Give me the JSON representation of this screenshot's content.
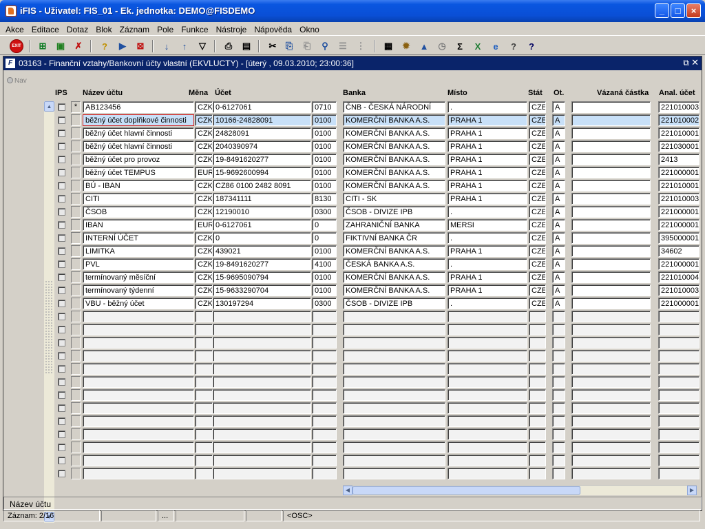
{
  "window": {
    "title": "iFIS - Uživatel: FIS_01 - Ek. jednotka: DEMO@FISDEMO",
    "minimize": "_",
    "maximize": "□",
    "close": "×"
  },
  "menu": [
    {
      "label": "Akce"
    },
    {
      "label": "Editace"
    },
    {
      "label": "Dotaz"
    },
    {
      "label": "Blok"
    },
    {
      "label": "Záznam"
    },
    {
      "label": "Pole"
    },
    {
      "label": "Funkce"
    },
    {
      "label": "Nástroje"
    },
    {
      "label": "Nápověda"
    },
    {
      "label": "Okno"
    }
  ],
  "toolbar": {
    "exit_label": "EXIT"
  },
  "form": {
    "icon_text": "F",
    "title": "03163 - Finanční vztahy/Bankovní účty vlastní (EKVLUCTY) - [úterý  , 09.03.2010; 23:00:36]",
    "restore": "⧉",
    "close": "✕",
    "nav_label": "Nav"
  },
  "columns": {
    "ips": "IPS",
    "nazev": "Název účtu",
    "mena": "Měna",
    "ucet": "Účet",
    "banka": "Banka",
    "misto": "Místo",
    "stat": "Stát",
    "ot": "Ot.",
    "vazana": "Vázaná částka",
    "anal": "Anal. účet"
  },
  "current_row_marker": "*",
  "rows": [
    {
      "nazev": "AB123456",
      "mena": "CZK",
      "ucet": "0-6127061",
      "kod": "0710",
      "banka": "ČNB - ČESKÁ NÁRODNÍ",
      "misto": ".",
      "stat": "CZE",
      "ot": "A",
      "vazana": "",
      "anal": "221010003"
    },
    {
      "nazev": "běžný účet doplňkové činnosti",
      "mena": "CZK",
      "ucet": "10166-24828091",
      "kod": "0100",
      "banka": "KOMERČNÍ BANKA A.S.",
      "misto": "PRAHA 1",
      "stat": "CZE",
      "ot": "A",
      "vazana": "",
      "anal": "221010002"
    },
    {
      "nazev": "běžný účet hlavní činnosti",
      "mena": "CZK",
      "ucet": "24828091",
      "kod": "0100",
      "banka": "KOMERČNÍ BANKA A.S.",
      "misto": "PRAHA 1",
      "stat": "CZE",
      "ot": "A",
      "vazana": "",
      "anal": "221010001"
    },
    {
      "nazev": "běžný účet hlavní činnosti",
      "mena": "CZK",
      "ucet": "2040390974",
      "kod": "0100",
      "banka": "KOMERČNÍ BANKA A.S.",
      "misto": "PRAHA 1",
      "stat": "CZE",
      "ot": "A",
      "vazana": "",
      "anal": "221030001"
    },
    {
      "nazev": "běžný účet pro provoz",
      "mena": "CZK",
      "ucet": "19-8491620277",
      "kod": "0100",
      "banka": "KOMERČNÍ BANKA A.S.",
      "misto": "PRAHA 1",
      "stat": "CZE",
      "ot": "A",
      "vazana": "",
      "anal": "2413"
    },
    {
      "nazev": "běžný účet TEMPUS",
      "mena": "EUR",
      "ucet": "15-9692600994",
      "kod": "0100",
      "banka": "KOMERČNÍ BANKA A.S.",
      "misto": "PRAHA 1",
      "stat": "CZE",
      "ot": "A",
      "vazana": "",
      "anal": "221000001"
    },
    {
      "nazev": "BÚ - IBAN",
      "mena": "CZK",
      "ucet": "CZ86 0100 2482 8091",
      "kod": "0100",
      "banka": "KOMERČNÍ BANKA A.S.",
      "misto": "PRAHA 1",
      "stat": "CZE",
      "ot": "A",
      "vazana": "",
      "anal": "221010001"
    },
    {
      "nazev": "CITI",
      "mena": "CZK",
      "ucet": "187341111",
      "kod": "8130",
      "banka": "CITI - SK",
      "misto": "PRAHA 1",
      "stat": "CZE",
      "ot": "A",
      "vazana": "",
      "anal": "221010003"
    },
    {
      "nazev": "ČSOB",
      "mena": "CZK",
      "ucet": "12190010",
      "kod": "0300",
      "banka": "ČSOB - DIVIZE IPB",
      "misto": ".",
      "stat": "CZE",
      "ot": "A",
      "vazana": "",
      "anal": "221000001"
    },
    {
      "nazev": "IBAN",
      "mena": "EUR",
      "ucet": "0-6127061",
      "kod": "0",
      "banka": "ZAHRANIČNÍ BANKA",
      "misto": "MERSI",
      "stat": "CZE",
      "ot": "A",
      "vazana": "",
      "anal": "221000001"
    },
    {
      "nazev": "INTERNÍ ÚČET",
      "mena": "CZK",
      "ucet": "0",
      "kod": "0",
      "banka": "FIKTIVNÍ BANKA ČR",
      "misto": ".",
      "stat": "CZE",
      "ot": "A",
      "vazana": "",
      "anal": "395000001"
    },
    {
      "nazev": "LIMITKA",
      "mena": "CZK",
      "ucet": "439021",
      "kod": "0100",
      "banka": "KOMERČNÍ BANKA A.S.",
      "misto": "PRAHA 1",
      "stat": "CZE",
      "ot": "A",
      "vazana": "",
      "anal": "34602"
    },
    {
      "nazev": "PVL",
      "mena": "CZK",
      "ucet": "19-8491620277",
      "kod": "4100",
      "banka": "ČESKÁ BANKA A.S.",
      "misto": ".",
      "stat": "CZE",
      "ot": "A",
      "vazana": "",
      "anal": "221000001"
    },
    {
      "nazev": "termínovaný měsíční",
      "mena": "CZK",
      "ucet": "15-9695090794",
      "kod": "0100",
      "banka": "KOMERČNÍ BANKA A.S.",
      "misto": "PRAHA 1",
      "stat": "CZE",
      "ot": "A",
      "vazana": "",
      "anal": "221010004"
    },
    {
      "nazev": "termínovaný týdenní",
      "mena": "CZK",
      "ucet": "15-9633290704",
      "kod": "0100",
      "banka": "KOMERČNÍ BANKA A.S.",
      "misto": "PRAHA 1",
      "stat": "CZE",
      "ot": "A",
      "vazana": "",
      "anal": "221010003"
    },
    {
      "nazev": "VBU - běžný účet",
      "mena": "CZK",
      "ucet": "130197294",
      "kod": "0300",
      "banka": "ČSOB - DIVIZE IPB",
      "misto": ".",
      "stat": "CZE",
      "ot": "A",
      "vazana": "",
      "anal": "221000001"
    }
  ],
  "empty_rows": 13,
  "selected_row": 2,
  "status": {
    "field_name": "Název účtu",
    "record": "Záznam: 2/16",
    "seg3": "...",
    "mode": "<OSC>"
  },
  "colors": {
    "title_blue": "#0a56e0",
    "inner_title": "#0a246a",
    "selection": "#c8e0f8",
    "focus_border": "#d02020"
  }
}
